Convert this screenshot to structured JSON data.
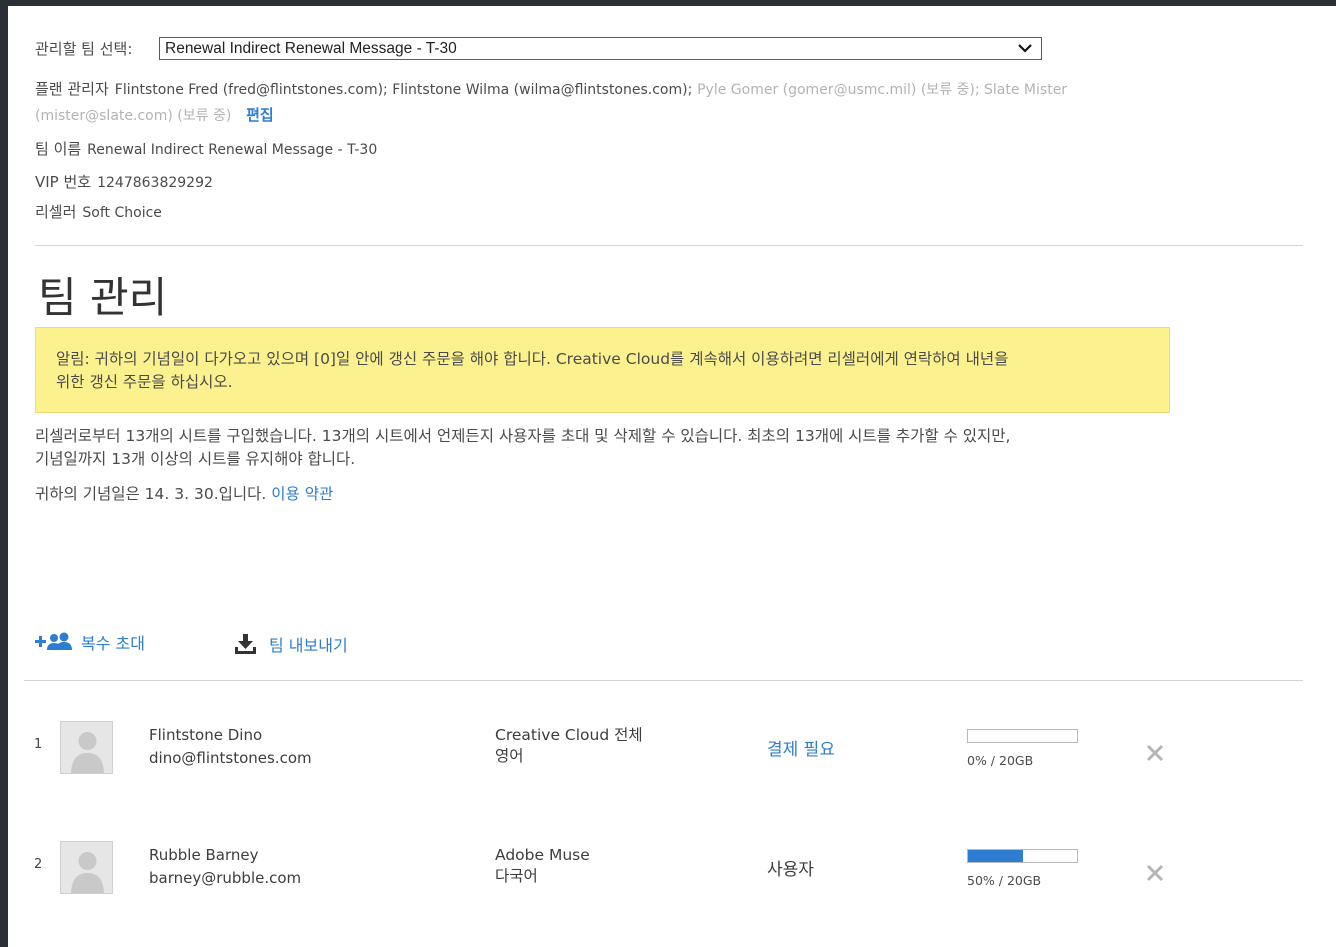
{
  "team_select": {
    "label": "관리할 팀 선택:",
    "value": "Renewal Indirect Renewal Message - T-30"
  },
  "plan_admins": {
    "label": "플랜 관리자",
    "active": "Flintstone Fred (fred@flintstones.com); Flintstone Wilma (wilma@flintstones.com);",
    "pending_line1": "Pyle Gomer (gomer@usmc.mil) (보류 중); Slate Mister",
    "pending_line2": "(mister@slate.com) (보류 중)",
    "edit_link": "편집"
  },
  "team_name": {
    "label": "팀 이름",
    "value": "Renewal Indirect Renewal Message - T-30"
  },
  "vip_number": {
    "label": "VIP 번호",
    "value": "1247863829292"
  },
  "reseller": {
    "label": "리셀러",
    "value": "Soft Choice"
  },
  "page_title": "팀 관리",
  "notice": {
    "line1": "알림: 귀하의 기념일이 다가오고 있으며 [0]일 안에 갱신 주문을 해야 합니다. Creative Cloud를 계속해서 이용하려면 리셀러에게 연락하여 내년을",
    "line2": "위한 갱신 주문을 하십시오."
  },
  "seats_info": {
    "line1": "리셀러로부터 13개의 시트를 구입했습니다. 13개의 시트에서 언제든지 사용자를 초대 및 삭제할 수 있습니다. 최초의 13개에 시트를 추가할 수 있지만,",
    "line2": "기념일까지 13개 이상의 시트를 유지해야 합니다."
  },
  "anniversary": {
    "text": "귀하의 기념일은 14. 3. 30.입니다.",
    "terms_link": "이용 약관"
  },
  "actions": {
    "invite_multiple": "복수 초대",
    "export_team": "팀 내보내기"
  },
  "colors": {
    "link": "#2d7dd2",
    "notice_bg": "#fbf28f",
    "progress": "#2d7dd2"
  },
  "users": [
    {
      "index": "1",
      "name": "Flintstone Dino",
      "email": "dino@flintstones.com",
      "product": "Creative Cloud 전체",
      "language": "영어",
      "status": "결제 필요",
      "status_is_link": true,
      "storage_fraction": 0,
      "storage_label": "0% / 20GB"
    },
    {
      "index": "2",
      "name": "Rubble Barney",
      "email": "barney@rubble.com",
      "product": "Adobe Muse",
      "language": "다국어",
      "status": "사용자",
      "status_is_link": false,
      "storage_fraction": 0.5,
      "storage_label": "50% / 20GB"
    }
  ]
}
